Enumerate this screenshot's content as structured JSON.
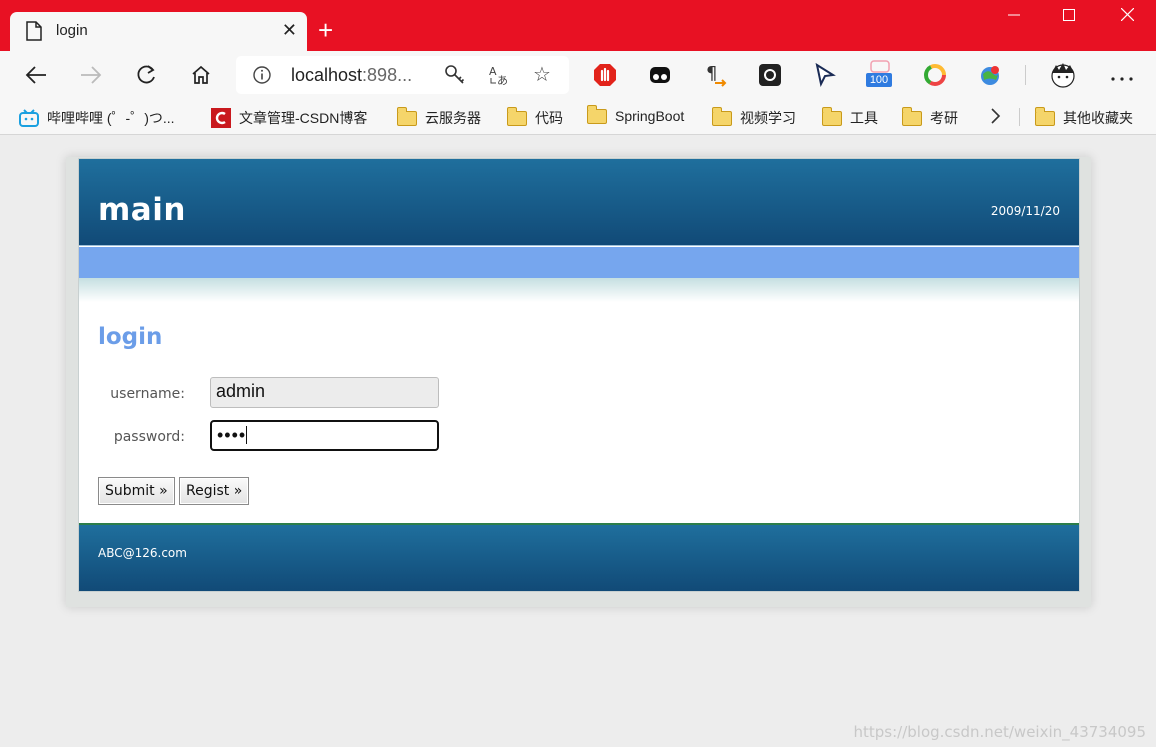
{
  "browser": {
    "tab_title": "login",
    "url_host": "localhost",
    "url_rest": ":898...",
    "extension_badge": "100",
    "icons": [
      "doc-icon",
      "close-icon",
      "plus-icon",
      "minimize-icon",
      "maximize-icon",
      "close-window-icon",
      "back-icon",
      "forward-icon",
      "refresh-icon",
      "home-icon",
      "info-icon",
      "key-icon",
      "translate-icon",
      "star-icon",
      "adblock-icon",
      "tampermonkey-icon",
      "pilcrow-icon",
      "github-icon",
      "cursor-icon",
      "extension-100-icon",
      "chrome-ring-icon",
      "globe-icon",
      "avatar-icon",
      "more-icon"
    ]
  },
  "bookmarks": [
    {
      "label": "哔哩哔哩 (゜-゜)つ...",
      "icon": "bilibili-icon"
    },
    {
      "label": "文章管理-CSDN博客",
      "icon": "csdn-icon"
    },
    {
      "label": "云服务器",
      "icon": "folder-icon"
    },
    {
      "label": "代码",
      "icon": "folder-icon"
    },
    {
      "label": "SpringBoot",
      "icon": "folder-icon"
    },
    {
      "label": "视频学习",
      "icon": "folder-icon"
    },
    {
      "label": "工具",
      "icon": "folder-icon"
    },
    {
      "label": "考研",
      "icon": "folder-icon"
    }
  ],
  "other_bookmarks": "其他收藏夹",
  "site": {
    "title": "main",
    "date": "2009/11/20",
    "section_title": "login",
    "username_label": "username:",
    "username_value": "admin",
    "password_label": "password:",
    "password_value": "••••",
    "submit_label": "Submit »",
    "regist_label": "Regist »",
    "footer_email": "ABC@126.com"
  },
  "watermark": "https://blog.csdn.net/weixin_43734095",
  "colors": {
    "titlebar": "#e81123",
    "header": "#1a5f8d",
    "menu_bar": "#76a6ee",
    "section_title": "#6b9de8"
  }
}
